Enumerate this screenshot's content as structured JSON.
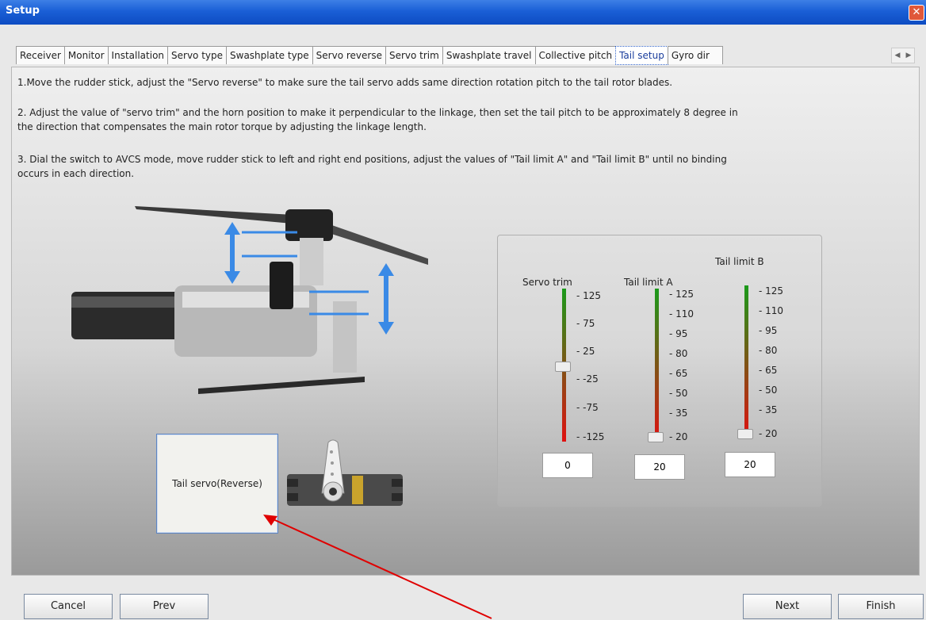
{
  "window": {
    "title": "Setup"
  },
  "tabs": [
    "Receiver",
    "Monitor",
    "Installation",
    "Servo type",
    "Swashplate type",
    "Servo reverse",
    "Servo trim",
    "Swashplate travel",
    "Collective pitch",
    "Tail setup",
    "Gyro dir"
  ],
  "active_tab": "Tail setup",
  "instructions": {
    "step1": "1.Move the rudder stick, adjust the \"Servo reverse\" to make sure the tail servo adds same direction rotation pitch to the tail rotor blades.",
    "step2a": "2. Adjust the value of \"servo trim\" and the horn position to make it perpendicular to the linkage, then set the tail pitch to be approximately 8 degree in",
    "step2b": "the direction that compensates the main rotor torque by adjusting the linkage length.",
    "step3a": "3. Dial the switch to AVCS mode, move rudder stick to left and right end positions, adjust the values of \"Tail limit A\" and \"Tail limit B\" until no binding",
    "step3b": "occurs in each direction."
  },
  "gauges": {
    "servo_trim": {
      "label": "Servo trim",
      "ticks": [
        "125",
        "75",
        "25",
        "-25",
        "-75",
        "-125"
      ],
      "value": "0"
    },
    "tail_limit_a": {
      "label": "Tail limit A",
      "ticks": [
        "125",
        "110",
        "95",
        "80",
        "65",
        "50",
        "35",
        "20"
      ],
      "value": "20"
    },
    "tail_limit_b": {
      "label": "Tail limit B",
      "ticks": [
        "125",
        "110",
        "95",
        "80",
        "65",
        "50",
        "35",
        "20"
      ],
      "value": "20"
    }
  },
  "servo_button": {
    "label": "Tail servo(Reverse)"
  },
  "buttons": {
    "cancel": "Cancel",
    "prev": "Prev",
    "next": "Next",
    "finish": "Finish"
  },
  "colors": {
    "titlebar": "#1a5fd6",
    "gauge_top": "#1a9a1a",
    "gauge_bottom": "#e01010",
    "arrow": "#e00000"
  },
  "icons": [
    "close-icon",
    "tab-scroll-left-icon",
    "tab-scroll-right-icon",
    "helicopter-tail-image",
    "servo-image"
  ]
}
